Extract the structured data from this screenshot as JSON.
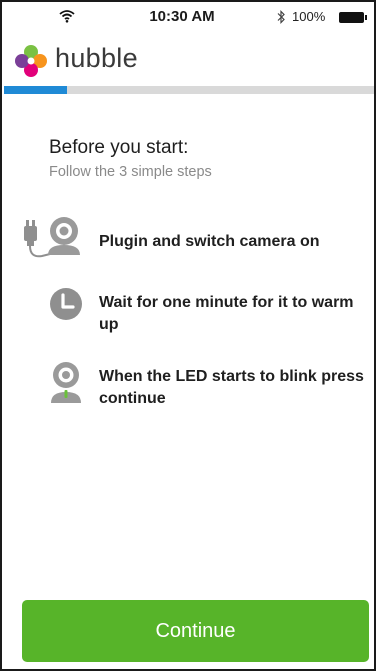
{
  "status_bar": {
    "time": "10:30 AM",
    "battery_percent": "100%",
    "icons": [
      "wifi-icon",
      "bluetooth-icon",
      "battery-icon"
    ]
  },
  "header": {
    "brand": "hubble",
    "logo_icon": "hubble-logo-icon",
    "progress_fraction": 0.17,
    "colors": {
      "progress": "#1f8ad6",
      "track": "#d9d9d9"
    }
  },
  "intro": {
    "title": "Before you start:",
    "subtitle": "Follow the 3 simple steps"
  },
  "steps": [
    {
      "icon": "camera-plug-icon",
      "text": "Plugin and switch camera on"
    },
    {
      "icon": "clock-icon",
      "text": "Wait for one minute for it to warm up"
    },
    {
      "icon": "camera-led-icon",
      "text": "When the LED starts to blink press continue"
    }
  ],
  "actions": {
    "continue_label": "Continue",
    "color": "#57b429"
  }
}
